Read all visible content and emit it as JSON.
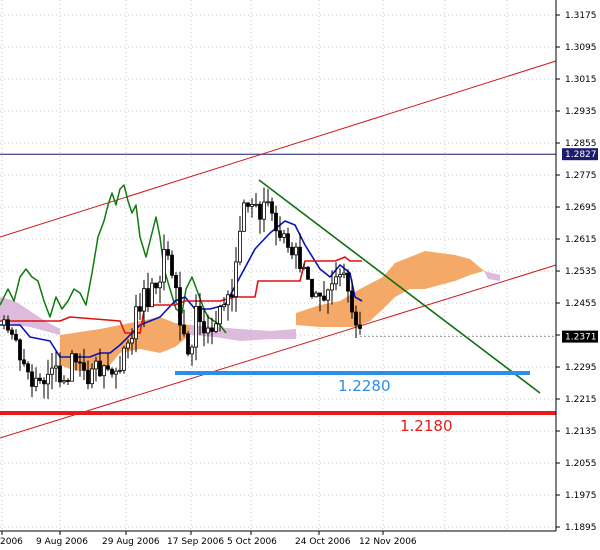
{
  "chart_data": {
    "type": "candlestick",
    "y_axis": {
      "ticks": [
        "1.3175",
        "1.3095",
        "1.3015",
        "1.2935",
        "1.2855",
        "1.2775",
        "1.2695",
        "1.2615",
        "1.2535",
        "1.2455",
        "1.2375",
        "1.2295",
        "1.2215",
        "1.2135",
        "1.2055",
        "1.1975",
        "1.1895"
      ],
      "range": [
        1.1895,
        1.3195
      ]
    },
    "x_axis": {
      "ticks": [
        "2006",
        "9 Aug 2006",
        "29 Aug 2006",
        "17 Sep 2006",
        "5 Oct 2006",
        "24 Oct 2006",
        "12 Nov 2006"
      ]
    },
    "markers": {
      "horizontal_line": {
        "value": 1.2827,
        "label": "1.2827",
        "color": "#1c1c6e"
      },
      "current_price": {
        "value": 1.2371,
        "label": "1.2371"
      }
    },
    "levels": [
      {
        "value": 1.228,
        "label": "1.2280",
        "color": "#2a8fe8"
      },
      {
        "value": 1.218,
        "label": "1.2180",
        "color": "#e61b1b"
      }
    ],
    "colors": {
      "candles": "#000000",
      "tenkan": "#0a14b4",
      "kijun": "#e01010",
      "chikou": "#107a10",
      "kumo_bull": "#f4a460",
      "kumo_bear": "#d8b4d8",
      "channel": "#d01818",
      "downtrend": "#0f6e0f"
    }
  }
}
